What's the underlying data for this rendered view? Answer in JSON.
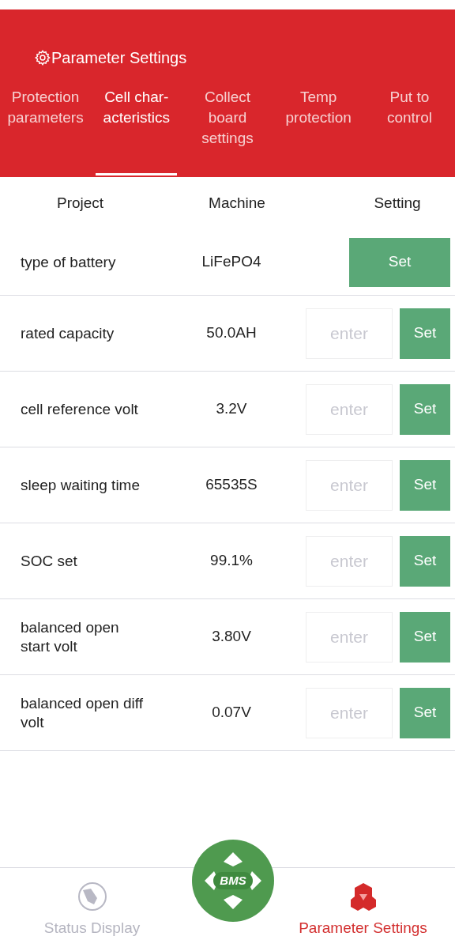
{
  "header": {
    "title": "Parameter Settings"
  },
  "tabs": [
    {
      "label": "Protection parameters",
      "selected": false
    },
    {
      "label": "Cell char-acteristics",
      "selected": true
    },
    {
      "label": "Collect board settings",
      "selected": false
    },
    {
      "label": "Temp protection",
      "selected": false
    },
    {
      "label": "Put to control",
      "selected": false
    }
  ],
  "table": {
    "columns": [
      "Project",
      "Machine",
      "Setting"
    ],
    "rows": [
      {
        "kind": "select",
        "project": "type of battery",
        "machine": "LiFePO4",
        "button": "Set"
      },
      {
        "kind": "input",
        "project": "rated capacity",
        "machine": "50.0AH",
        "placeholder": "enter",
        "button": "Set"
      },
      {
        "kind": "input",
        "project": "cell reference volt",
        "machine": "3.2V",
        "placeholder": "enter",
        "button": "Set"
      },
      {
        "kind": "input",
        "project": "sleep waiting time",
        "machine": "65535S",
        "placeholder": "enter",
        "button": "Set"
      },
      {
        "kind": "input",
        "project": "SOC set",
        "machine": "99.1%",
        "placeholder": "enter",
        "button": "Set"
      },
      {
        "kind": "input",
        "project": "balanced open start volt",
        "machine": "3.80V",
        "placeholder": "enter",
        "button": "Set"
      },
      {
        "kind": "input",
        "project": "balanced open diff volt",
        "machine": "0.07V",
        "placeholder": "enter",
        "button": "Set"
      }
    ]
  },
  "bottom_nav": {
    "center_logo": "BMS",
    "items": [
      {
        "label": "Status Display",
        "selected": false
      },
      {
        "label": "Parameter Settings",
        "selected": true
      }
    ]
  }
}
